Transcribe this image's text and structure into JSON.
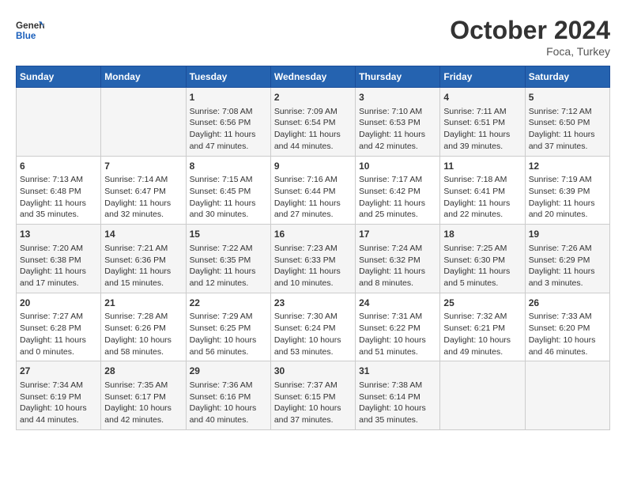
{
  "header": {
    "logo_general": "General",
    "logo_blue": "Blue",
    "month": "October 2024",
    "location": "Foca, Turkey"
  },
  "weekdays": [
    "Sunday",
    "Monday",
    "Tuesday",
    "Wednesday",
    "Thursday",
    "Friday",
    "Saturday"
  ],
  "weeks": [
    [
      {
        "day": null
      },
      {
        "day": null
      },
      {
        "day": 1,
        "sunrise": "7:08 AM",
        "sunset": "6:56 PM",
        "daylight": "11 hours and 47 minutes."
      },
      {
        "day": 2,
        "sunrise": "7:09 AM",
        "sunset": "6:54 PM",
        "daylight": "11 hours and 44 minutes."
      },
      {
        "day": 3,
        "sunrise": "7:10 AM",
        "sunset": "6:53 PM",
        "daylight": "11 hours and 42 minutes."
      },
      {
        "day": 4,
        "sunrise": "7:11 AM",
        "sunset": "6:51 PM",
        "daylight": "11 hours and 39 minutes."
      },
      {
        "day": 5,
        "sunrise": "7:12 AM",
        "sunset": "6:50 PM",
        "daylight": "11 hours and 37 minutes."
      }
    ],
    [
      {
        "day": 6,
        "sunrise": "7:13 AM",
        "sunset": "6:48 PM",
        "daylight": "11 hours and 35 minutes."
      },
      {
        "day": 7,
        "sunrise": "7:14 AM",
        "sunset": "6:47 PM",
        "daylight": "11 hours and 32 minutes."
      },
      {
        "day": 8,
        "sunrise": "7:15 AM",
        "sunset": "6:45 PM",
        "daylight": "11 hours and 30 minutes."
      },
      {
        "day": 9,
        "sunrise": "7:16 AM",
        "sunset": "6:44 PM",
        "daylight": "11 hours and 27 minutes."
      },
      {
        "day": 10,
        "sunrise": "7:17 AM",
        "sunset": "6:42 PM",
        "daylight": "11 hours and 25 minutes."
      },
      {
        "day": 11,
        "sunrise": "7:18 AM",
        "sunset": "6:41 PM",
        "daylight": "11 hours and 22 minutes."
      },
      {
        "day": 12,
        "sunrise": "7:19 AM",
        "sunset": "6:39 PM",
        "daylight": "11 hours and 20 minutes."
      }
    ],
    [
      {
        "day": 13,
        "sunrise": "7:20 AM",
        "sunset": "6:38 PM",
        "daylight": "11 hours and 17 minutes."
      },
      {
        "day": 14,
        "sunrise": "7:21 AM",
        "sunset": "6:36 PM",
        "daylight": "11 hours and 15 minutes."
      },
      {
        "day": 15,
        "sunrise": "7:22 AM",
        "sunset": "6:35 PM",
        "daylight": "11 hours and 12 minutes."
      },
      {
        "day": 16,
        "sunrise": "7:23 AM",
        "sunset": "6:33 PM",
        "daylight": "11 hours and 10 minutes."
      },
      {
        "day": 17,
        "sunrise": "7:24 AM",
        "sunset": "6:32 PM",
        "daylight": "11 hours and 8 minutes."
      },
      {
        "day": 18,
        "sunrise": "7:25 AM",
        "sunset": "6:30 PM",
        "daylight": "11 hours and 5 minutes."
      },
      {
        "day": 19,
        "sunrise": "7:26 AM",
        "sunset": "6:29 PM",
        "daylight": "11 hours and 3 minutes."
      }
    ],
    [
      {
        "day": 20,
        "sunrise": "7:27 AM",
        "sunset": "6:28 PM",
        "daylight": "11 hours and 0 minutes."
      },
      {
        "day": 21,
        "sunrise": "7:28 AM",
        "sunset": "6:26 PM",
        "daylight": "10 hours and 58 minutes."
      },
      {
        "day": 22,
        "sunrise": "7:29 AM",
        "sunset": "6:25 PM",
        "daylight": "10 hours and 56 minutes."
      },
      {
        "day": 23,
        "sunrise": "7:30 AM",
        "sunset": "6:24 PM",
        "daylight": "10 hours and 53 minutes."
      },
      {
        "day": 24,
        "sunrise": "7:31 AM",
        "sunset": "6:22 PM",
        "daylight": "10 hours and 51 minutes."
      },
      {
        "day": 25,
        "sunrise": "7:32 AM",
        "sunset": "6:21 PM",
        "daylight": "10 hours and 49 minutes."
      },
      {
        "day": 26,
        "sunrise": "7:33 AM",
        "sunset": "6:20 PM",
        "daylight": "10 hours and 46 minutes."
      }
    ],
    [
      {
        "day": 27,
        "sunrise": "7:34 AM",
        "sunset": "6:19 PM",
        "daylight": "10 hours and 44 minutes."
      },
      {
        "day": 28,
        "sunrise": "7:35 AM",
        "sunset": "6:17 PM",
        "daylight": "10 hours and 42 minutes."
      },
      {
        "day": 29,
        "sunrise": "7:36 AM",
        "sunset": "6:16 PM",
        "daylight": "10 hours and 40 minutes."
      },
      {
        "day": 30,
        "sunrise": "7:37 AM",
        "sunset": "6:15 PM",
        "daylight": "10 hours and 37 minutes."
      },
      {
        "day": 31,
        "sunrise": "7:38 AM",
        "sunset": "6:14 PM",
        "daylight": "10 hours and 35 minutes."
      },
      {
        "day": null
      },
      {
        "day": null
      }
    ]
  ]
}
